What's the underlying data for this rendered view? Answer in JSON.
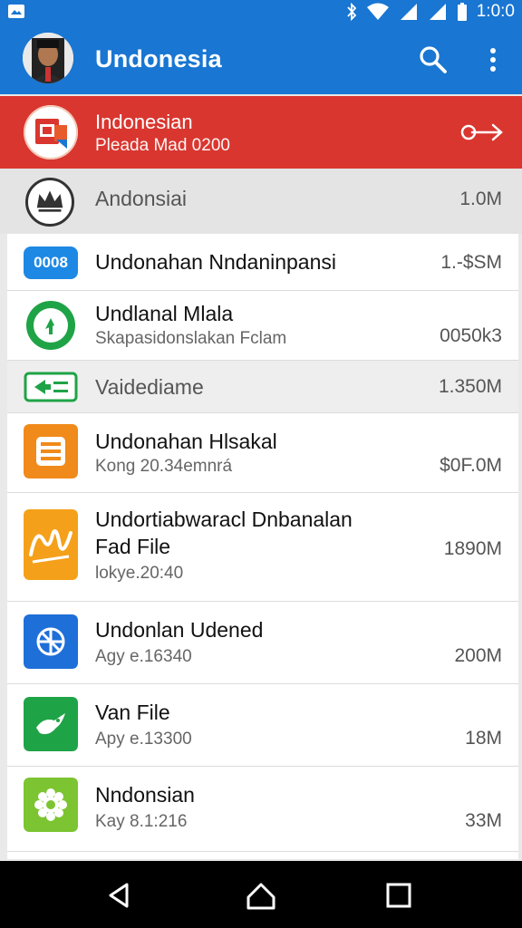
{
  "status_bar": {
    "time": "1:0:0",
    "icons": [
      "image-notification-icon",
      "bluetooth-icon",
      "wifi-icon",
      "signal-icon",
      "signal-icon",
      "battery-icon"
    ]
  },
  "app_bar": {
    "title": "Undonesia",
    "icons": [
      "avatar",
      "search-icon",
      "more-vert-icon"
    ]
  },
  "promo": {
    "title": "Indonesian",
    "subtitle": "Pleada Mad 0200",
    "action_icon": "share-arrow-icon"
  },
  "summary": {
    "label": "Andonsiai",
    "size": "1.0M"
  },
  "items": [
    {
      "icon_text": "0008",
      "name": "Undonahan Nndaninpansi",
      "sub": "",
      "size": "1.-$SM",
      "icon": "code-icon"
    },
    {
      "name": "Undlanal Mlala",
      "sub": "Skapasidonslakan Fclam",
      "size": "0050k3",
      "icon": "refresh-icon"
    },
    {
      "name": "Vaidediame",
      "sub": "",
      "size": "1.350M",
      "icon": "exit-icon"
    },
    {
      "name": "Undonahan Hlsakal",
      "sub": "Kong 20.34emnrá",
      "size": "$0F.0M",
      "icon": "document-icon"
    },
    {
      "name": "Undortiabwaracl Dnbanalan",
      "name2": "Fad File",
      "sub": "lokye.20:40",
      "size": "1890M",
      "icon": "signature-icon"
    },
    {
      "name": "Undonlan Udened",
      "sub": "Agy e.16340",
      "size": "200M",
      "icon": "globe-icon"
    },
    {
      "name": "Van File",
      "sub": "Apy e.13300",
      "size": "18M",
      "icon": "bird-icon"
    },
    {
      "name": "Nndonsian",
      "sub": "Kay 8.1:216",
      "size": "33M",
      "icon": "gear-icon"
    }
  ],
  "colors": {
    "primary": "#1976d2",
    "promo": "#d9362f",
    "blue_icon": "#1e88e5",
    "green": "#1fa347",
    "orange": "#f08a1a",
    "lime": "#7cc431"
  },
  "nav": [
    "back-icon",
    "home-icon",
    "recents-icon"
  ]
}
